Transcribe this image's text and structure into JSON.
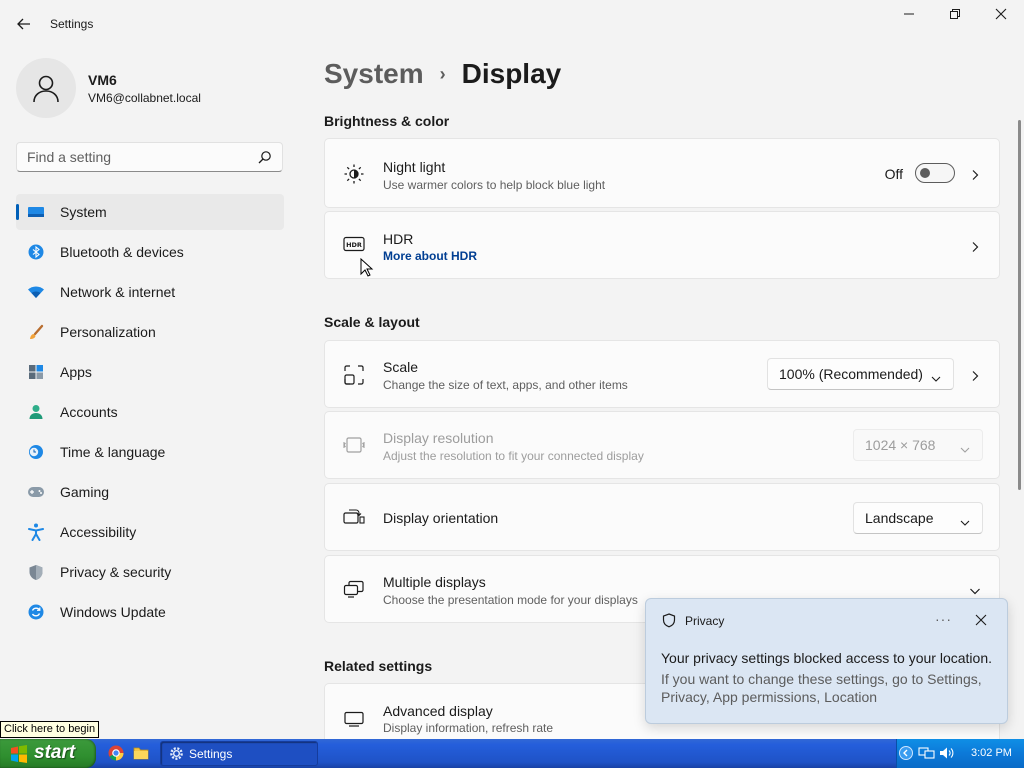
{
  "window": {
    "title": "Settings"
  },
  "profile": {
    "name": "VM6",
    "email": "VM6@collabnet.local"
  },
  "search": {
    "placeholder": "Find a setting"
  },
  "nav": {
    "items": [
      {
        "label": "System",
        "icon": "system-icon",
        "active": true
      },
      {
        "label": "Bluetooth & devices",
        "icon": "bluetooth-icon"
      },
      {
        "label": "Network & internet",
        "icon": "wifi-icon"
      },
      {
        "label": "Personalization",
        "icon": "brush-icon"
      },
      {
        "label": "Apps",
        "icon": "apps-icon"
      },
      {
        "label": "Accounts",
        "icon": "person-icon"
      },
      {
        "label": "Time & language",
        "icon": "clock-globe-icon"
      },
      {
        "label": "Gaming",
        "icon": "gamepad-icon"
      },
      {
        "label": "Accessibility",
        "icon": "accessibility-icon"
      },
      {
        "label": "Privacy & security",
        "icon": "shield-icon"
      },
      {
        "label": "Windows Update",
        "icon": "update-icon"
      }
    ]
  },
  "breadcrumb": {
    "parent": "System",
    "separator": "›",
    "current": "Display"
  },
  "sections": {
    "brightness": "Brightness & color",
    "scale": "Scale & layout",
    "related": "Related settings"
  },
  "settings": {
    "night_light": {
      "title": "Night light",
      "subtitle": "Use warmer colors to help block blue light",
      "state_label": "Off"
    },
    "hdr": {
      "title": "HDR",
      "link": "More about HDR"
    },
    "scale": {
      "title": "Scale",
      "subtitle": "Change the size of text, apps, and other items",
      "value": "100% (Recommended)"
    },
    "resolution": {
      "title": "Display resolution",
      "subtitle": "Adjust the resolution to fit your connected display",
      "value": "1024 × 768"
    },
    "orientation": {
      "title": "Display orientation",
      "value": "Landscape"
    },
    "multiple": {
      "title": "Multiple displays",
      "subtitle": "Choose the presentation mode for your displays"
    },
    "advanced": {
      "title": "Advanced display",
      "subtitle": "Display information, refresh rate"
    }
  },
  "toast": {
    "title": "Privacy",
    "more": "···",
    "message": "Your privacy settings blocked access to your location.",
    "detail": "If you want to change these settings, go to Settings, Privacy, App permissions, Location"
  },
  "taskbar": {
    "start_label": "start",
    "tooltip": "Click here to begin",
    "task_label": "Settings",
    "clock": "3:02 PM"
  },
  "colors": {
    "accent": "#005fb8",
    "taskbar": "#245edb",
    "start": "#2f8f2f",
    "toast_bg": "#dbe6f3"
  }
}
